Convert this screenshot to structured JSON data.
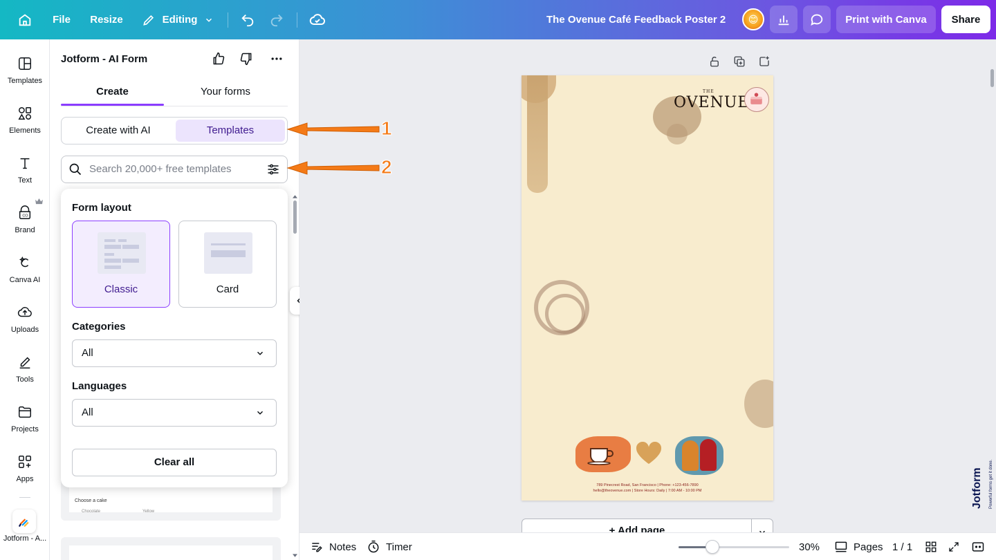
{
  "topbar": {
    "file_label": "File",
    "resize_label": "Resize",
    "editing_label": "Editing",
    "doc_title": "The Ovenue Café Feedback Poster 2",
    "print_label": "Print with Canva",
    "share_label": "Share"
  },
  "rail": {
    "items": [
      {
        "label": "Templates",
        "icon": "templates-icon"
      },
      {
        "label": "Elements",
        "icon": "elements-icon"
      },
      {
        "label": "Text",
        "icon": "text-icon"
      },
      {
        "label": "Brand",
        "icon": "brand-icon"
      },
      {
        "label": "Canva AI",
        "icon": "canva-ai-icon"
      },
      {
        "label": "Uploads",
        "icon": "uploads-icon"
      },
      {
        "label": "Tools",
        "icon": "tools-icon"
      },
      {
        "label": "Projects",
        "icon": "projects-icon"
      },
      {
        "label": "Apps",
        "icon": "apps-icon"
      }
    ],
    "app_label": "Jotform - A..."
  },
  "panel": {
    "title": "Jotform - AI Form",
    "tabs": [
      {
        "label": "Create",
        "active": true
      },
      {
        "label": "Your forms",
        "active": false
      }
    ],
    "segments": [
      {
        "label": "Create with AI",
        "active": false
      },
      {
        "label": "Templates",
        "active": true
      }
    ],
    "search_placeholder": "Search 20,000+ free templates",
    "peek_card": {
      "question": "Choose a cake",
      "options": [
        "Chocolate",
        "Yellow"
      ]
    }
  },
  "filter": {
    "form_layout_heading": "Form layout",
    "layouts": [
      {
        "label": "Classic",
        "selected": true
      },
      {
        "label": "Card",
        "selected": false
      }
    ],
    "categories_heading": "Categories",
    "categories_value": "All",
    "languages_heading": "Languages",
    "languages_value": "All",
    "clear_label": "Clear all"
  },
  "poster": {
    "brand_small": "THE",
    "brand_name": "OVENUE",
    "footer_line1": "789 Pinecrest Road, San Francisco | Phone: +123-456-7890",
    "footer_line2": "hello@theovenue.com | Store Hours: Daily | 7:00 AM - 10:00 PM"
  },
  "canvas": {
    "add_page_label": "+ Add page"
  },
  "bottombar": {
    "notes_label": "Notes",
    "timer_label": "Timer",
    "zoom_value": "30%",
    "pages_label": "Pages",
    "page_count": "1 / 1"
  },
  "jotform_brand": {
    "word": "Jotform",
    "tagline": "Powerful forms get it done."
  },
  "annotations": [
    "1",
    "2"
  ],
  "colors": {
    "accent": "#8b3dff",
    "arrow": "#f47a17",
    "poster_bg": "#f8ecce"
  }
}
